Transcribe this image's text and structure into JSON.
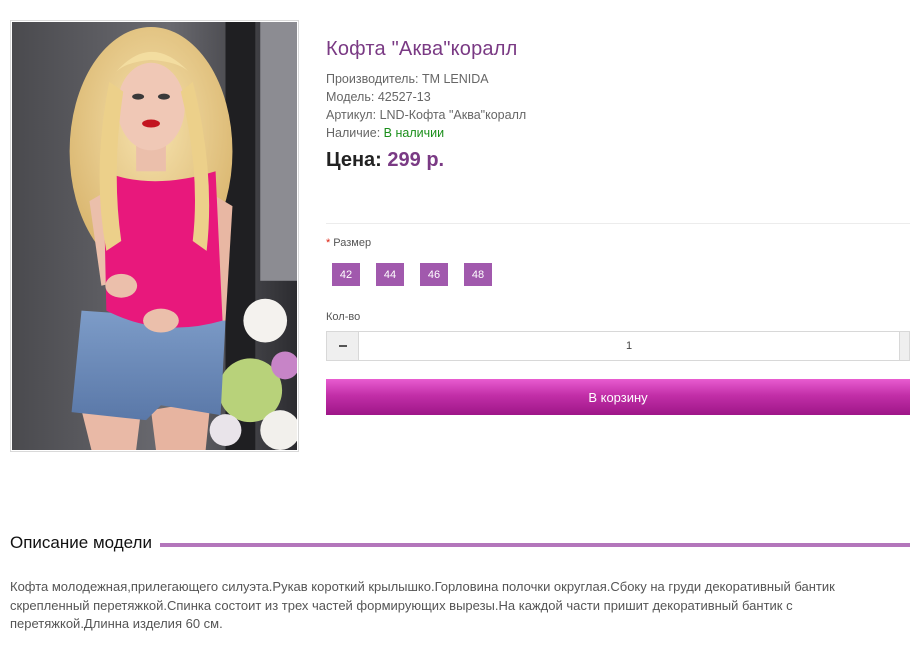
{
  "product": {
    "title": "Кофта \"Аква\"коралл",
    "manufacturer_label": "Производитель:",
    "manufacturer": "TM LENIDA",
    "model_label": "Модель:",
    "model": "42527-13",
    "sku_label": "Артикул:",
    "sku": "LND-Кофта \"Аква\"коралл",
    "availability_label": "Наличие:",
    "availability": "В наличии",
    "price_label": "Цена:",
    "price": "299 р."
  },
  "options": {
    "required_mark": "*",
    "size_label": "Размер",
    "sizes": [
      "42",
      "44",
      "46",
      "48"
    ],
    "quantity_label": "Кол-во",
    "quantity": "1"
  },
  "actions": {
    "add_to_cart": "В корзину"
  },
  "description": {
    "heading": "Описание модели",
    "text": "Кофта молодежная,прилегающего силуэта.Рукав короткий крылышко.Горловина полочки округлая.Сбоку на груди декоративный бантик скрепленный перетяжкой.Спинка состоит из трех частей формирующих вырезы.На каждой части пришит декоративный бантик с перетяжкой.Длинна изделия 60 см."
  },
  "colors": {
    "accent": "#7a3a84",
    "size_button": "#a159ad",
    "in_stock": "#1a8f1a",
    "cart_button": "#c22fa8",
    "heading_rule": "#b376bb"
  }
}
